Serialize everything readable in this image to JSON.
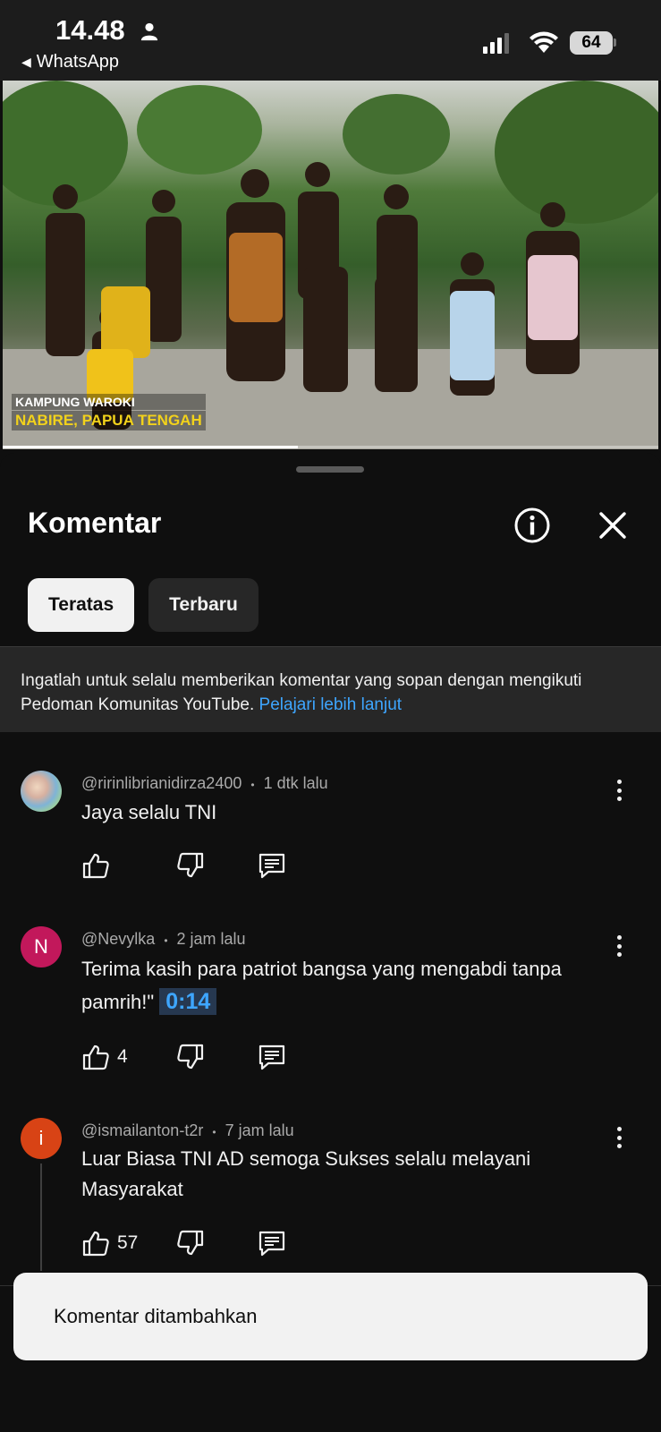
{
  "status_bar": {
    "time": "14.48",
    "back_app": "WhatsApp",
    "battery": "64"
  },
  "video": {
    "caption_line1": "KAMPUNG WAROKI",
    "caption_line2": "NABIRE, PAPUA TENGAH",
    "progress_fraction": 0.45
  },
  "comments_panel": {
    "title": "Komentar",
    "info_icon": "info-icon",
    "close_icon": "close-icon",
    "chips": [
      {
        "label": "Teratas",
        "active": true
      },
      {
        "label": "Terbaru",
        "active": false
      }
    ],
    "notice_text": "Ingatlah untuk selalu memberikan komentar yang sopan dengan mengikuti Pedoman Komunitas YouTube. ",
    "notice_link": "Pelajari lebih lanjut"
  },
  "comments": [
    {
      "author": "@ririnlibrianidirza2400",
      "time": "1 dtk lalu",
      "text": "Jaya selalu TNI",
      "likes": "",
      "avatar": "photo"
    },
    {
      "author": "@Nevylka",
      "time": "2 jam lalu",
      "text": "Terima kasih para patriot bangsa yang mengabdi tanpa pamrih!\" ",
      "timestamp": "0:14",
      "likes": "4",
      "avatar_letter": "N"
    },
    {
      "author": "@ismailanton-t2r",
      "time": "7 jam lalu",
      "text": "Luar Biasa TNI AD semoga Sukses selalu melayani Masyarakat",
      "likes": "57",
      "avatar_letter": "i"
    }
  ],
  "meta_separator": "•",
  "toast": {
    "message": "Komentar ditambahkan"
  },
  "icons": {
    "like": "thumb-up-icon",
    "dislike": "thumb-down-icon",
    "reply": "reply-icon",
    "more": "more-vert-icon"
  },
  "colors": {
    "background": "#0f0f0f",
    "link": "#3ea6ff",
    "avatar_n": "#c2185b",
    "avatar_i": "#d84315",
    "caption_yellow": "#f2d21b"
  }
}
